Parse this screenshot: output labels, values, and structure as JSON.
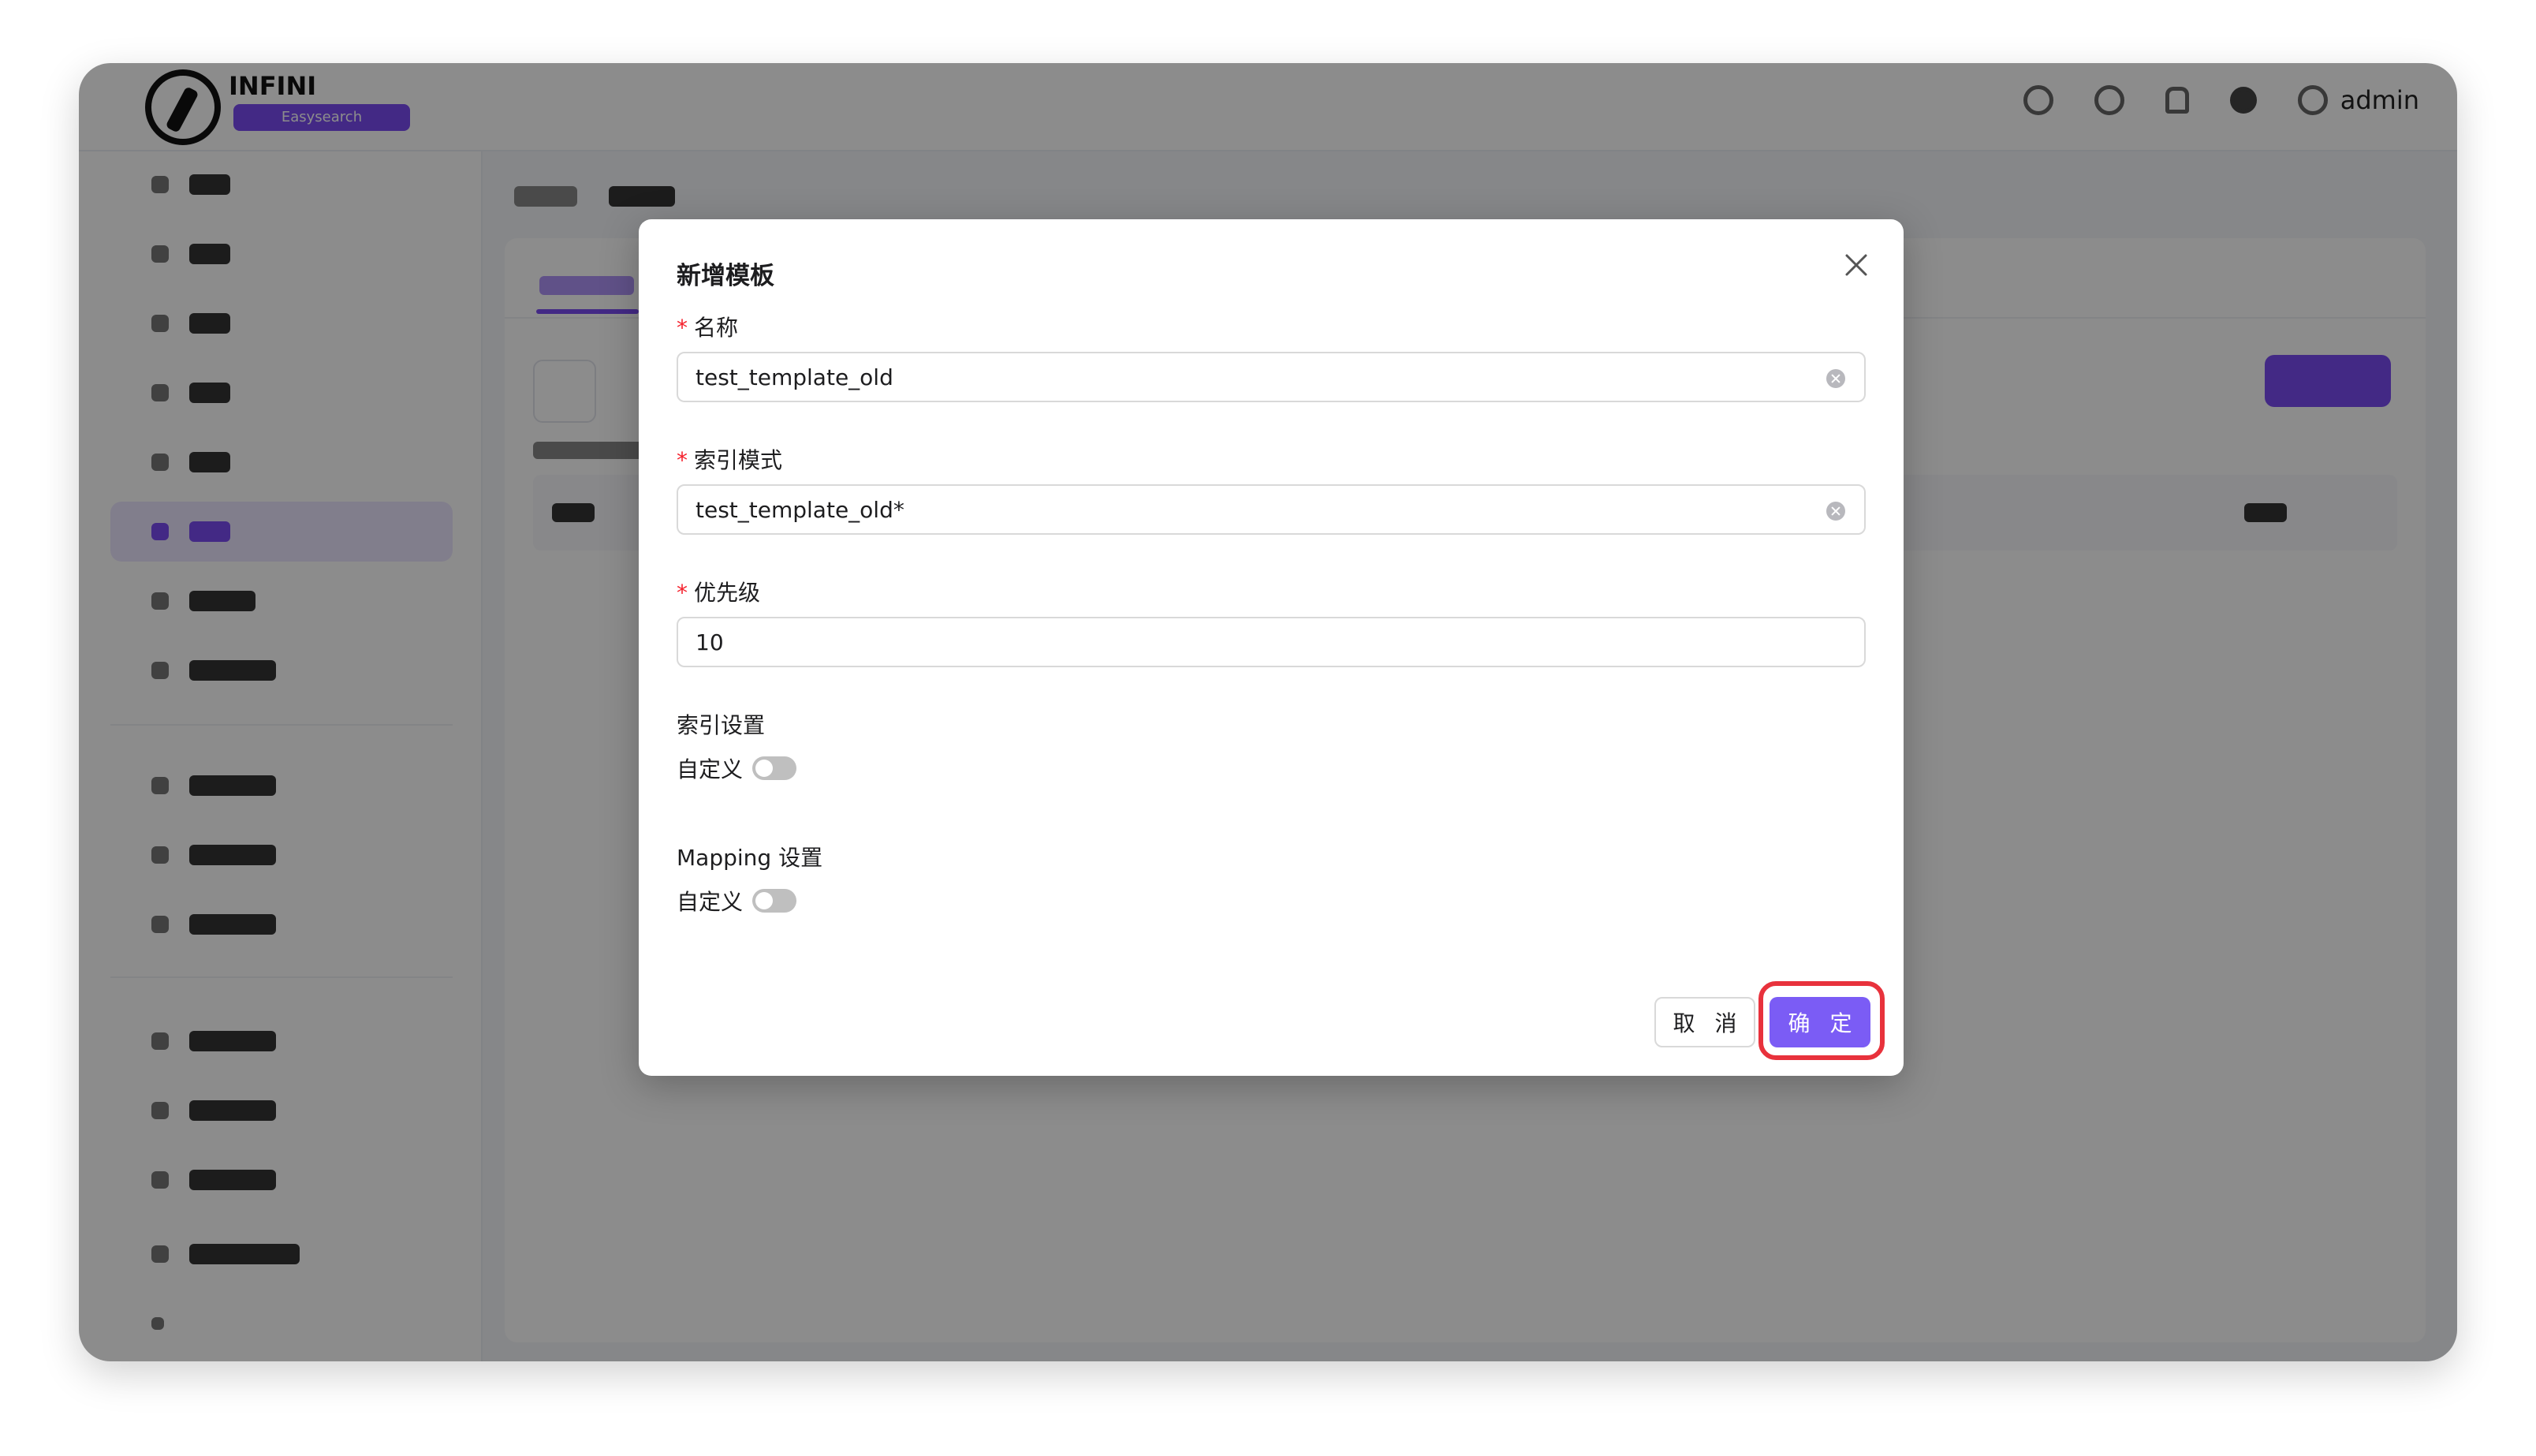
{
  "app": {
    "logo_text": "INFINI",
    "logo_badge": "Easysearch",
    "user_name": "admin",
    "top_icons": [
      "globe-icon",
      "message-icon",
      "bell-icon",
      "theme-icon",
      "user-icon"
    ]
  },
  "modal": {
    "title": "新增模板",
    "fields": {
      "name": {
        "label": "名称",
        "required_mark": "*",
        "value": "test_template_old"
      },
      "index_pattern": {
        "label": "索引模式",
        "required_mark": "*",
        "value": "test_template_old*"
      },
      "priority": {
        "label": "优先级",
        "required_mark": "*",
        "value": "10"
      }
    },
    "index_settings": {
      "section_label": "索引设置",
      "toggle_label": "自定义",
      "toggle_on": false
    },
    "mapping_settings": {
      "section_label": "Mapping 设置",
      "toggle_label": "自定义",
      "toggle_on": false
    },
    "buttons": {
      "cancel": "取 消",
      "confirm": "确 定"
    }
  },
  "colors": {
    "accent": "#7b5cf5",
    "highlight": "#e8323c",
    "required": "#f5222d"
  }
}
